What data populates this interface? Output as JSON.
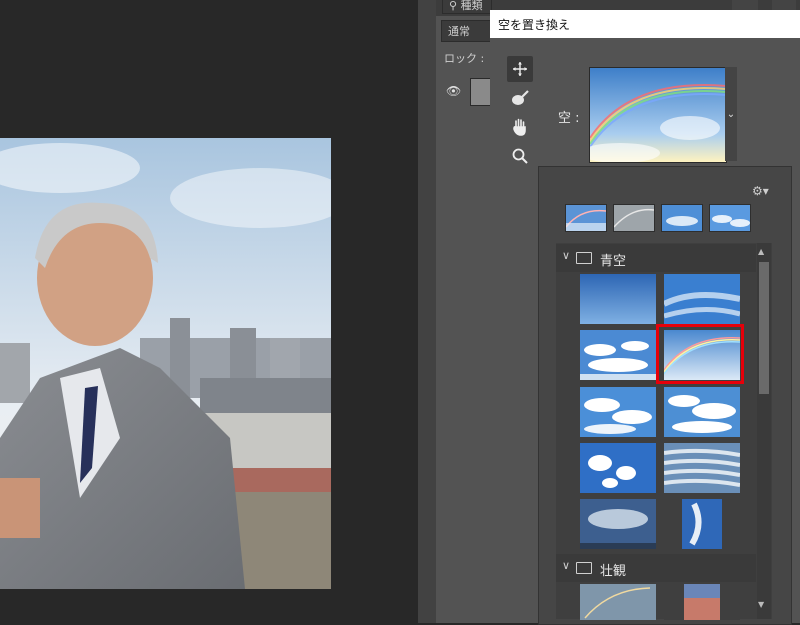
{
  "layers_panel": {
    "search_placeholder": "種類",
    "blend_mode": "通常",
    "lock_label": "ロック :"
  },
  "dialog": {
    "title": "空を置き換え",
    "sky_label": "空 :",
    "tools": [
      "move-icon",
      "sky-brush-icon",
      "hand-icon",
      "zoom-icon"
    ]
  },
  "sky_popup": {
    "settings_icon": "gear-icon",
    "recent_count": 4,
    "groups": [
      {
        "name": "青空",
        "expanded": true
      },
      {
        "name": "壮観",
        "expanded": true
      }
    ],
    "selected": "rainbow"
  },
  "colors": {
    "canvas_bg": "#282828",
    "panel_bg": "#535353",
    "highlight": "#e6000a"
  }
}
